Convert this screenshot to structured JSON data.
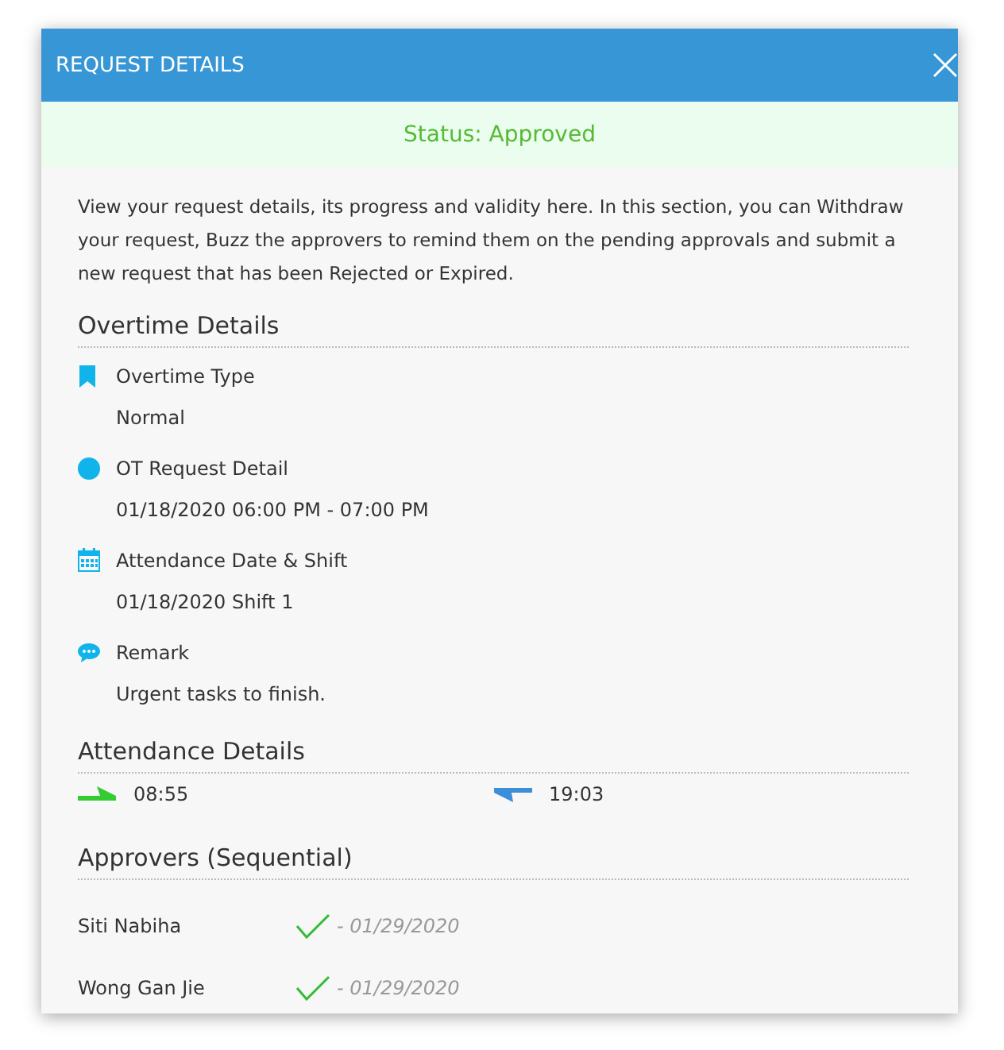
{
  "dialog": {
    "title": "REQUEST DETAILS"
  },
  "status": {
    "text": "Status: Approved",
    "kind": "approved"
  },
  "description": "View your request details, its progress and validity here. In this section, you can Withdraw your request, Buzz the approvers to remind them on the pending approvals and submit a new request that has been Rejected or Expired.",
  "overtime": {
    "heading": "Overtime Details",
    "items": [
      {
        "kind": "bookmark",
        "label": "Overtime Type",
        "value": "Normal"
      },
      {
        "kind": "circle",
        "label": "OT Request Detail",
        "value": "01/18/2020 06:00 PM - 07:00 PM"
      },
      {
        "kind": "calendar",
        "label": "Attendance Date & Shift",
        "value": "01/18/2020 Shift 1"
      },
      {
        "kind": "chat",
        "label": "Remark",
        "value": "Urgent tasks to finish."
      }
    ]
  },
  "attendance": {
    "heading": "Attendance Details",
    "entries": [
      {
        "kind": "in",
        "time": "08:55"
      },
      {
        "kind": "out",
        "time": "19:03"
      }
    ]
  },
  "approvers": {
    "heading": "Approvers (Sequential)",
    "rows": [
      {
        "name": "Siti Nabiha",
        "approved": true,
        "date": "- 01/29/2020"
      },
      {
        "name": "Wong Gan Jie",
        "approved": true,
        "date": "- 01/29/2020"
      }
    ]
  }
}
